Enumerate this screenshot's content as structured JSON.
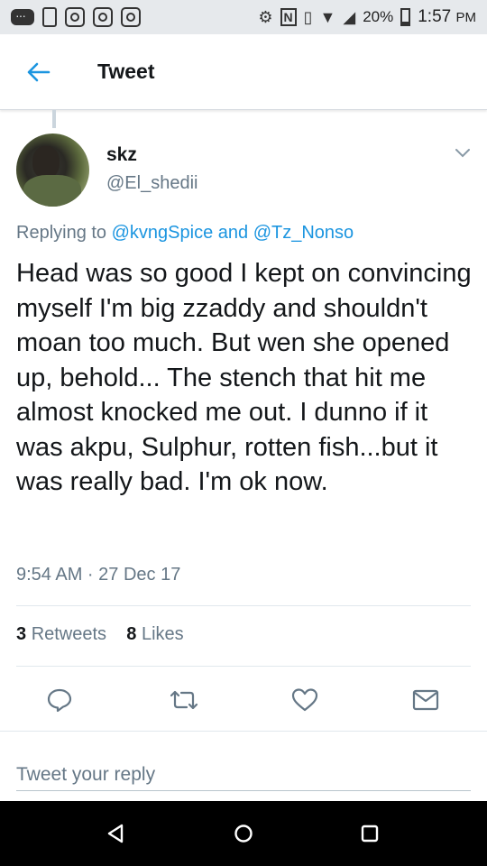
{
  "status_bar": {
    "battery_percent": "20%",
    "time": "1:57",
    "time_suffix": "PM"
  },
  "header": {
    "title": "Tweet"
  },
  "tweet": {
    "author_name": "skz",
    "author_handle": "@El_shedii",
    "replying_prefix": "Replying to ",
    "reply_to_1": "@kvngSpice",
    "reply_and": " and ",
    "reply_to_2": "@Tz_Nonso",
    "text": "Head was so good I kept on convincing myself I'm big zzaddy and shouldn't moan too much. But wen she opened up, behold... The stench that hit me almost knocked me out. I dunno if it was akpu, Sulphur, rotten fish...but it was really bad. I'm ok now.",
    "timestamp": "9:54 AM · 27 Dec 17",
    "retweets_count": "3",
    "retweets_label": "Retweets",
    "likes_count": "8",
    "likes_label": "Likes"
  },
  "reply_box": {
    "placeholder": "Tweet your reply"
  },
  "colors": {
    "accent": "#1b95e0",
    "secondary_text": "#657786",
    "status_bar_bg": "#e6e9ec",
    "nav_bar_bg": "#000000"
  },
  "icons": [
    "back-arrow-icon",
    "chevron-down-icon",
    "reply-icon",
    "retweet-icon",
    "like-icon",
    "direct-message-icon",
    "nav-back-icon",
    "nav-home-icon",
    "nav-recents-icon"
  ]
}
